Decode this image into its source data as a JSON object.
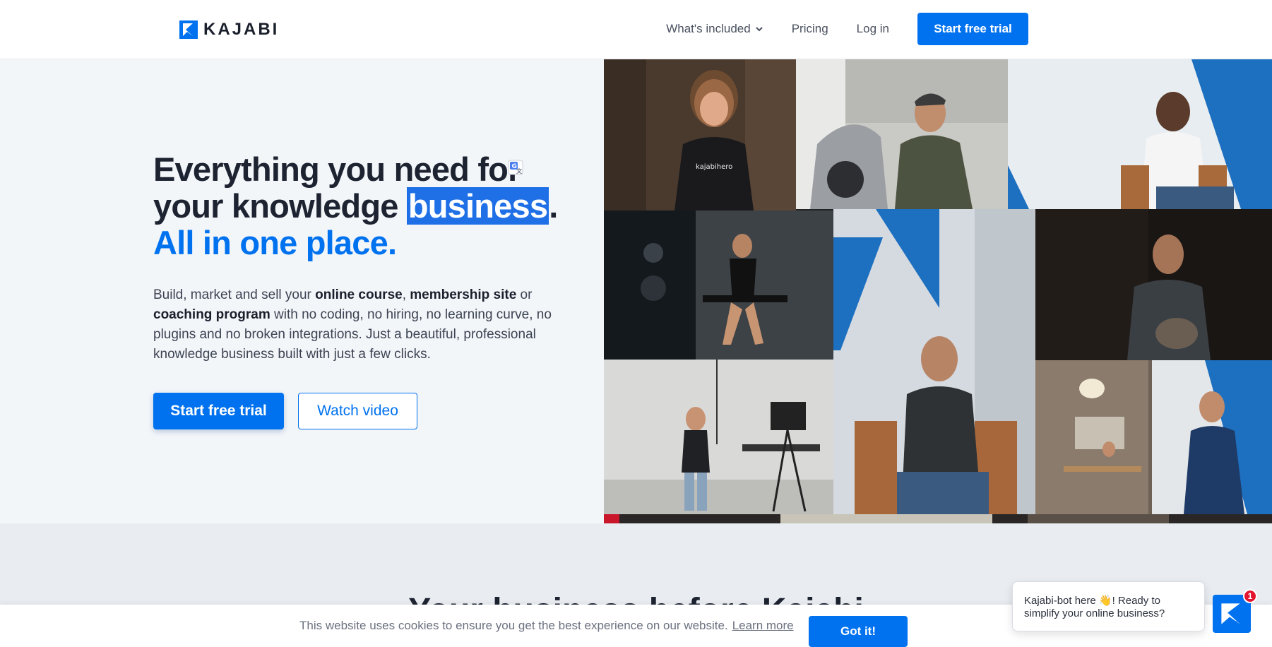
{
  "header": {
    "logo_text": "KAJABI",
    "nav": {
      "whats_included": "What's included",
      "pricing": "Pricing",
      "login": "Log in",
      "cta": "Start free trial"
    }
  },
  "hero": {
    "headline_line1": "Everything you need for",
    "headline_line2_pre": "your knowledge ",
    "headline_line2_highlight": "business",
    "headline_line2_post": ".",
    "headline_accent": "All in one place.",
    "desc_1": "Build, market and sell your ",
    "desc_b1": "online course",
    "desc_2": ", ",
    "desc_b2": "membership site",
    "desc_3": " or ",
    "desc_b3": "coaching program",
    "desc_4": " with no coding, no hiring, no learning curve, no plugins and no broken integrations. Just a beautiful, professional knowledge business built with just a few clicks.",
    "cta_primary": "Start free trial",
    "cta_secondary": "Watch video"
  },
  "collage": {
    "shirt_text": "kajabihero"
  },
  "section2": {
    "title": "Your business before Kajabi"
  },
  "cookie": {
    "text": "This website uses cookies to ensure you get the best experience on our website.",
    "learn_more": "Learn more",
    "button": "Got it!"
  },
  "chat": {
    "message": "Kajabi-bot here 👋! Ready to simplify your online business?",
    "badge_count": "1"
  },
  "colors": {
    "brand_blue": "#0072ef",
    "hero_bg": "#f3f6f9",
    "badge_red": "#e3142d"
  }
}
